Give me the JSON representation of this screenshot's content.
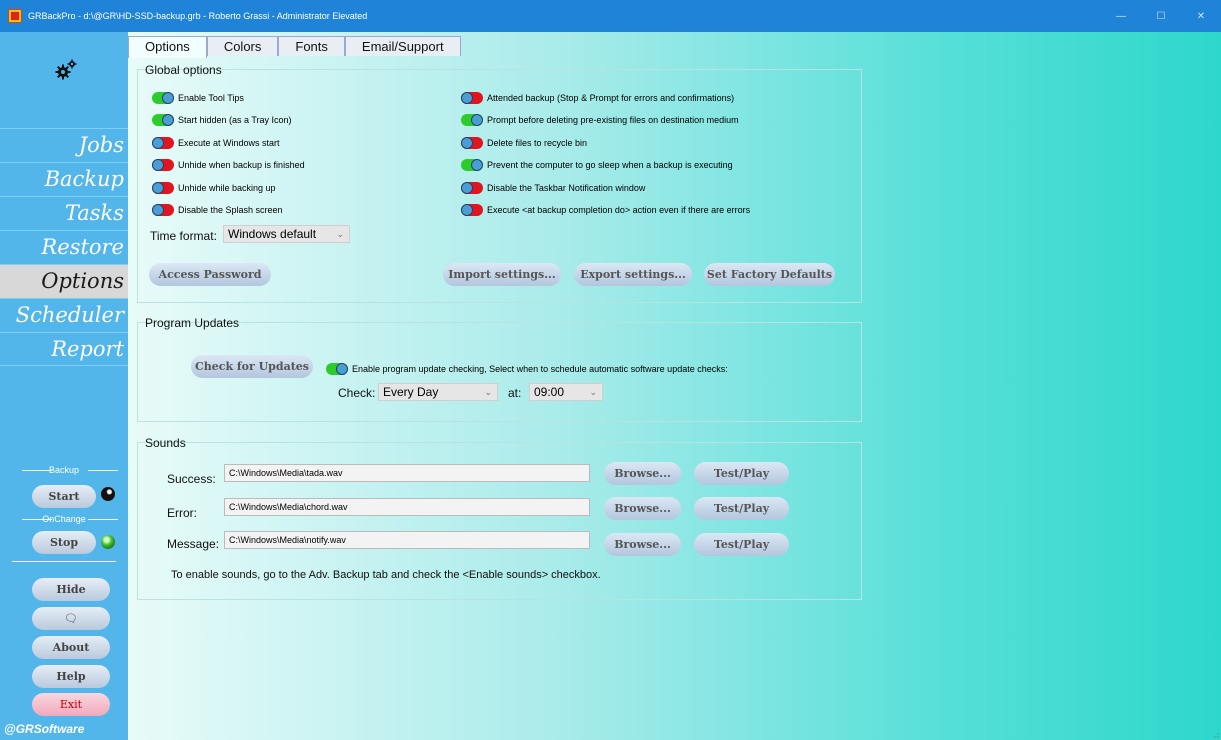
{
  "window": {
    "title": "GRBackPro - d:\\@GR\\HD-SSD-backup.grb - Roberto Grassi - Administrator Elevated",
    "minimize": "—",
    "maximize": "☐",
    "close": "✕"
  },
  "sidebar": {
    "nav": [
      "Jobs",
      "Backup",
      "Tasks",
      "Restore",
      "Options",
      "Scheduler",
      "Report"
    ],
    "active": "Options",
    "backup_label": "Backup",
    "start_label": "Start",
    "onchange_label": "OnChange",
    "stop_label": "Stop",
    "hide_label": "Hide",
    "chat_icon": "🗨",
    "about_label": "About",
    "help_label": "Help",
    "exit_label": "Exit",
    "brand": "@GRSoftware"
  },
  "tabs": [
    "Options",
    "Colors",
    "Fonts",
    "Email/Support"
  ],
  "global": {
    "title": "Global options",
    "left_options": [
      {
        "label": "Enable Tool Tips",
        "on": true
      },
      {
        "label": "Start hidden (as a Tray Icon)",
        "on": true
      },
      {
        "label": "Execute at Windows start",
        "on": false
      },
      {
        "label": "Unhide when backup is finished",
        "on": false
      },
      {
        "label": "Unhide while backing up",
        "on": false
      },
      {
        "label": "Disable the Splash screen",
        "on": false
      }
    ],
    "right_options": [
      {
        "label": "Attended backup (Stop & Prompt for errors and confirmations)",
        "on": false
      },
      {
        "label": "Prompt before deleting pre-existing files on destination medium",
        "on": true
      },
      {
        "label": "Delete files to recycle bin",
        "on": false
      },
      {
        "label": "Prevent the computer to go sleep when a backup is executing",
        "on": true
      },
      {
        "label": "Disable the Taskbar Notification window",
        "on": false
      },
      {
        "label": "Execute <at backup completion do> action even if there are errors",
        "on": false
      }
    ],
    "time_format_label": "Time format:",
    "time_format_value": "Windows default",
    "access_password": "Access Password",
    "import_settings": "Import settings...",
    "export_settings": "Export settings...",
    "factory_defaults": "Set Factory Defaults"
  },
  "updates": {
    "title": "Program Updates",
    "check_button": "Check for Updates",
    "enable_label": "Enable program update checking, Select when to schedule automatic software update checks:",
    "enable_on": true,
    "check_label": "Check:",
    "check_value": "Every Day",
    "at_label": "at:",
    "at_value": "09:00"
  },
  "sounds": {
    "title": "Sounds",
    "rows": [
      {
        "label": "Success:",
        "path": "C:\\Windows\\Media\\tada.wav"
      },
      {
        "label": "Error:",
        "path": "C:\\Windows\\Media\\chord.wav"
      },
      {
        "label": "Message:",
        "path": "C:\\Windows\\Media\\notify.wav"
      }
    ],
    "browse_label": "Browse...",
    "test_label": "Test/Play",
    "note": "To enable sounds, go to the Adv. Backup tab and check the <Enable sounds> checkbox."
  }
}
